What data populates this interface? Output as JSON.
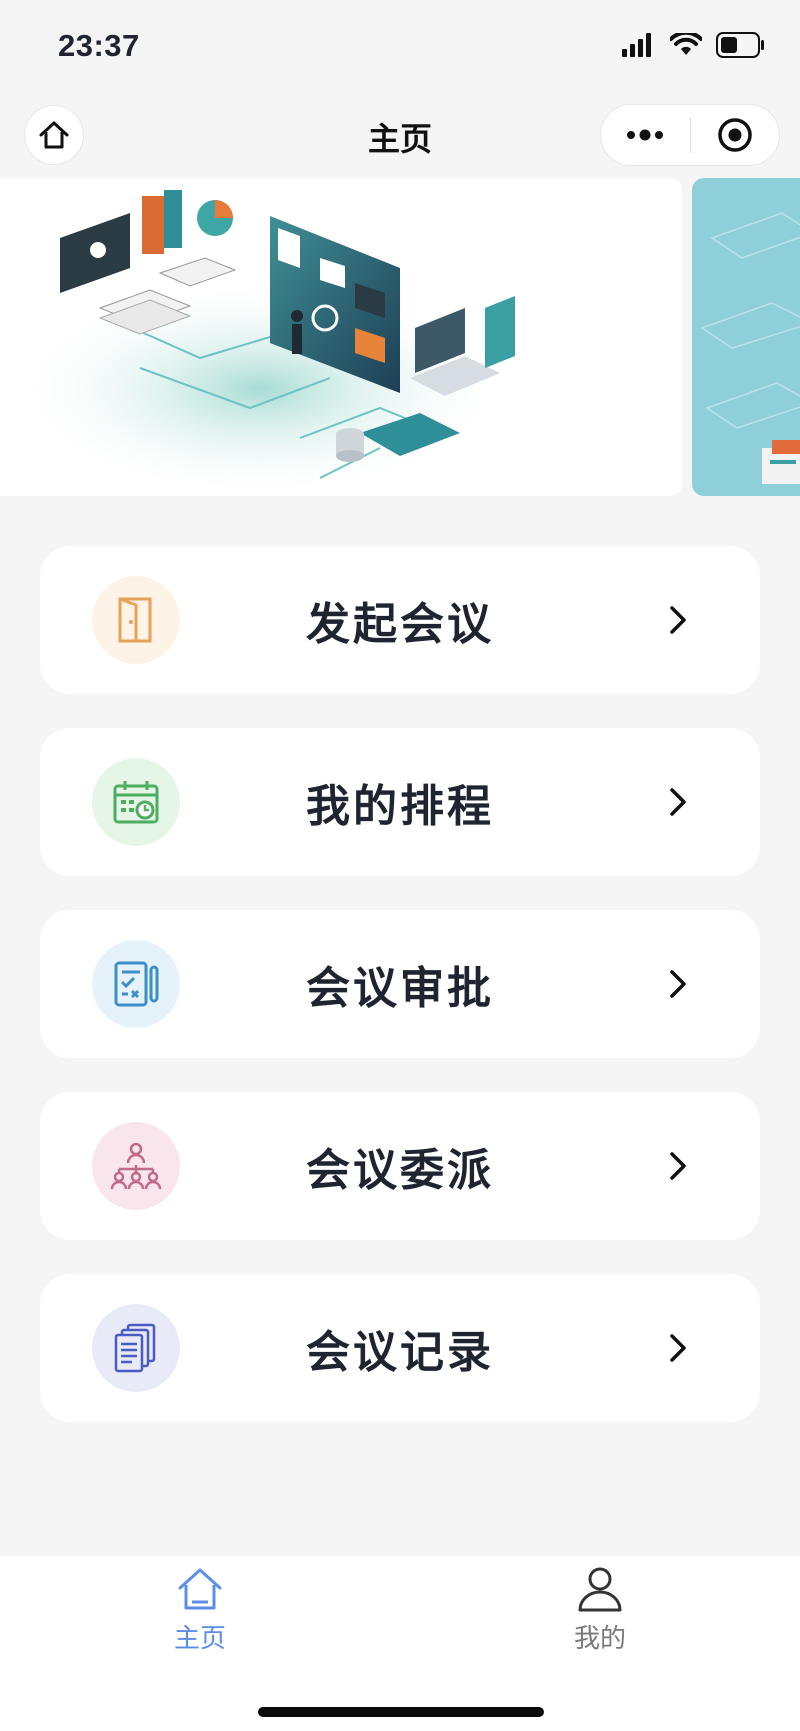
{
  "status_bar": {
    "time": "23:37"
  },
  "nav": {
    "title": "主页"
  },
  "menu": [
    {
      "label": "发起会议",
      "icon": "door-icon",
      "icon_color": "#e8a25a",
      "icon_bg": "#fdf3e7"
    },
    {
      "label": "我的排程",
      "icon": "calendar-clock-icon",
      "icon_color": "#4cae5e",
      "icon_bg": "#e6f6e6"
    },
    {
      "label": "会议审批",
      "icon": "approval-document-icon",
      "icon_color": "#3d8fc8",
      "icon_bg": "#e6f2fa"
    },
    {
      "label": "会议委派",
      "icon": "org-chart-icon",
      "icon_color": "#c36b86",
      "icon_bg": "#f8e6ec"
    },
    {
      "label": "会议记录",
      "icon": "documents-stack-icon",
      "icon_color": "#4a5bc4",
      "icon_bg": "#e8eaf8"
    }
  ],
  "tabs": [
    {
      "label": "主页",
      "icon": "home-icon",
      "active": true
    },
    {
      "label": "我的",
      "icon": "person-icon",
      "active": false
    }
  ],
  "colors": {
    "active_tab": "#5b8ee6",
    "inactive_tab": "#7a7a7a",
    "background": "#f5f5f5"
  }
}
